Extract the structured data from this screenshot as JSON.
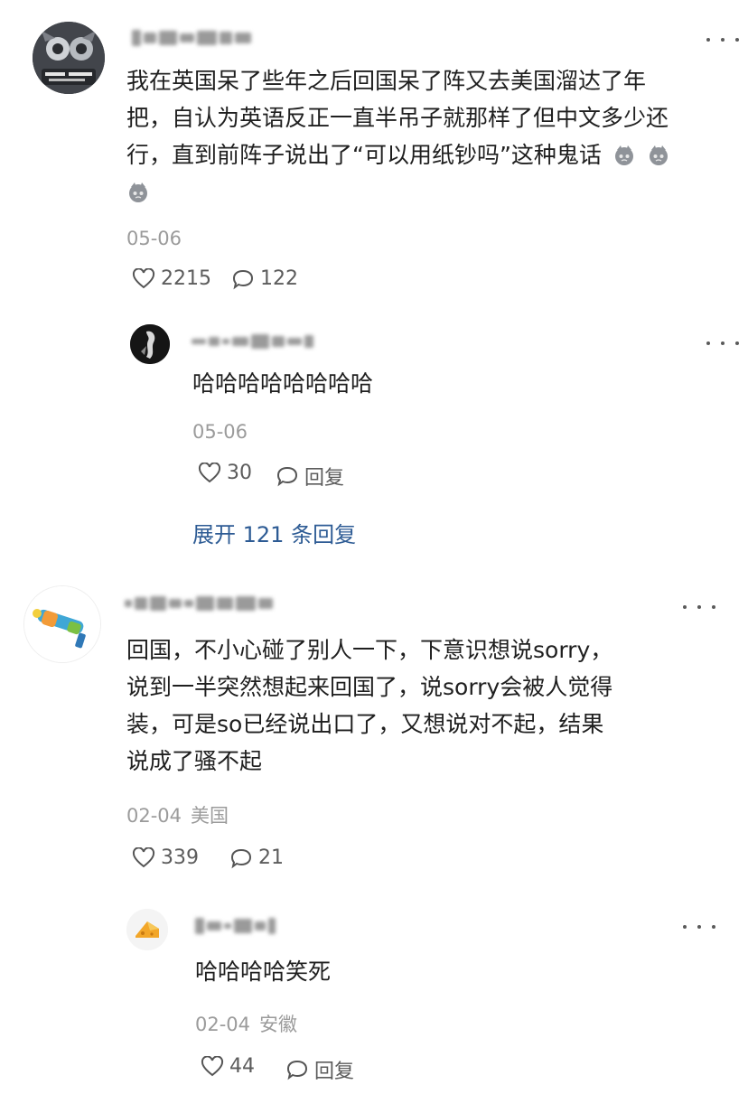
{
  "comments": [
    {
      "text_lines": [
        "我在英国呆了些年之后回国呆了阵又去美国溜达了年",
        "把，自认为英语反正一直半吊子就那样了但中文多少还",
        "行，直到前阵子说出了“可以用纸钞吗”这种鬼话"
      ],
      "emoji_icon": "gray-cat-emoji",
      "date": "05-06",
      "location": "",
      "likes": "2215",
      "replies": "122",
      "reply": {
        "text": "哈哈哈哈哈哈哈哈",
        "date": "05-06",
        "location": "",
        "likes": "30",
        "reply_label": "回复"
      },
      "expand_label": "展开 121 条回复"
    },
    {
      "text_lines": [
        "回国，不小心碰了别人一下，下意识想说sorry，",
        "说到一半突然想起来回国了，说sorry会被人觉得",
        "装，可是so已经说出口了，又想说对不起，结果",
        "说成了骚不起"
      ],
      "date": "02-04",
      "location": "美国",
      "likes": "339",
      "replies": "21",
      "reply": {
        "text": "哈哈哈哈笑死",
        "date": "02-04",
        "location": "安徽",
        "likes": "44",
        "reply_label": "回复"
      }
    }
  ],
  "icons": {
    "like": "heart-icon",
    "comment": "speech-bubble-icon",
    "more": "more-options-icon"
  },
  "colors": {
    "link": "#2d5b94",
    "meta": "#9b9b9b",
    "text": "#1f1f1f"
  }
}
